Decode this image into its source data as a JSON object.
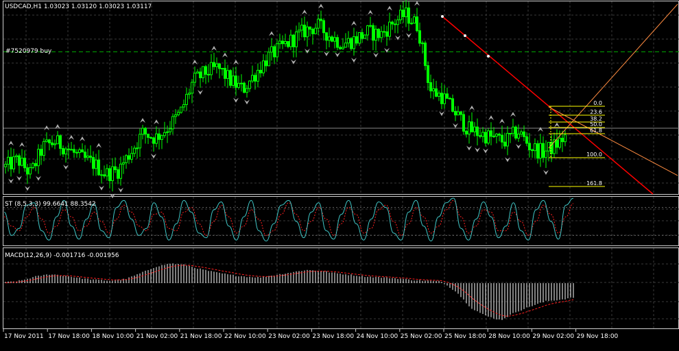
{
  "header": {
    "symbol_line": "USDCAD,H1  1.03023 1.03120 1.03023 1.03117",
    "order_label": "#7520979 buy"
  },
  "stochastic": {
    "label": "ST (8,5,3,3) 99.6641 88.3542"
  },
  "macd": {
    "label": "MACD(12,26,9) -0.001716 -0.001956"
  },
  "colors": {
    "background": "#000000",
    "grid": "#3a3a3a",
    "candle_bull": "#00ff00",
    "candle_bear": "#00ff00",
    "order_line": "#00aa00",
    "trendline": "#ff0000",
    "trendline2": "#ff8c40",
    "fibo": "#ffff00",
    "stoch_main": "#40c8c8",
    "stoch_signal": "#ff2020",
    "macd_hist": "#ffffff",
    "macd_signal": "#ff2020",
    "fractal": "#b0b0b0"
  },
  "fibonacci": {
    "levels": [
      "0.0",
      "23.6",
      "38.2",
      "50.0",
      "61.8",
      "100.0",
      "161.8"
    ]
  },
  "chart_data": {
    "type": "candlestick",
    "symbol": "USDCAD",
    "timeframe": "H1",
    "x_tick_labels": [
      "17 Nov 2011",
      "17 Nov 18:00",
      "18 Nov 10:00",
      "21 Nov 02:00",
      "21 Nov 18:00",
      "22 Nov 10:00",
      "23 Nov 02:00",
      "23 Nov 18:00",
      "24 Nov 10:00",
      "25 Nov 02:00",
      "25 Nov 18:00",
      "28 Nov 10:00",
      "29 Nov 02:00",
      "29 Nov 18:00"
    ],
    "last_quote": {
      "open": 1.03023,
      "high": 1.0312,
      "low": 1.03023,
      "close": 1.03117
    },
    "close_path": [
      1.024,
      1.0248,
      1.0232,
      1.0262,
      1.0268,
      1.026,
      1.025,
      1.0244,
      1.0232,
      1.0236,
      1.0256,
      1.0278,
      1.0272,
      1.0284,
      1.03,
      1.0335,
      1.0345,
      1.035,
      1.0336,
      1.0326,
      1.0344,
      1.0362,
      1.0372,
      1.0382,
      1.0392,
      1.0397,
      1.0385,
      1.0377,
      1.0382,
      1.039,
      1.0387,
      1.04,
      1.041,
      1.0397,
      1.0325,
      1.0318,
      1.03,
      1.0282,
      1.0277,
      1.0272,
      1.0268,
      1.028,
      1.0262,
      1.0256,
      1.0264,
      1.0276
    ],
    "order_level": 1.0368,
    "stochastic": {
      "levels": [
        20,
        80
      ],
      "main": [
        70,
        20,
        35,
        85,
        90,
        30,
        10,
        60,
        95,
        40,
        12,
        55,
        88,
        30,
        15,
        80,
        95,
        55,
        20,
        35,
        90,
        60,
        10,
        45,
        95,
        70,
        25,
        15,
        75,
        92,
        40,
        10,
        60,
        95,
        30,
        8,
        45,
        85,
        95,
        50,
        15,
        70,
        90,
        30,
        12,
        65,
        95,
        45,
        10,
        55,
        92,
        80,
        25,
        10,
        70,
        95,
        40,
        8,
        60,
        90,
        100,
        35,
        10,
        55,
        92,
        60,
        15,
        40,
        90,
        30,
        10,
        75,
        95,
        50,
        12,
        85,
        99.66
      ],
      "signal": [
        60,
        40,
        30,
        60,
        80,
        55,
        25,
        40,
        75,
        60,
        30,
        40,
        70,
        50,
        25,
        55,
        85,
        70,
        40,
        30,
        65,
        70,
        35,
        30,
        70,
        80,
        45,
        20,
        50,
        85,
        60,
        25,
        40,
        75,
        55,
        20,
        30,
        65,
        90,
        65,
        30,
        50,
        80,
        55,
        20,
        45,
        80,
        65,
        25,
        35,
        75,
        85,
        50,
        20,
        45,
        80,
        60,
        25,
        40,
        75,
        95,
        60,
        25,
        40,
        75,
        70,
        30,
        30,
        70,
        50,
        20,
        50,
        85,
        65,
        25,
        60,
        88.35
      ]
    },
    "macd": {
      "last_main": -0.001716,
      "last_signal": -0.001956,
      "histogram_path": [
        0.0001,
        0.0003,
        0.0008,
        0.0011,
        0.0009,
        0.0006,
        0.0004,
        0.0003,
        0.0005,
        0.0012,
        0.002,
        0.0024,
        0.0022,
        0.0017,
        0.0013,
        0.001,
        0.0008,
        0.0007,
        0.001,
        0.0013,
        0.0016,
        0.0015,
        0.0012,
        0.001,
        0.0008,
        0.0007,
        0.0006,
        0.0004,
        0.0003,
        0.0002,
        -0.001,
        -0.003,
        -0.004,
        -0.0045,
        -0.0035,
        -0.0028,
        -0.0022,
        -0.002,
        -0.0017
      ]
    }
  }
}
